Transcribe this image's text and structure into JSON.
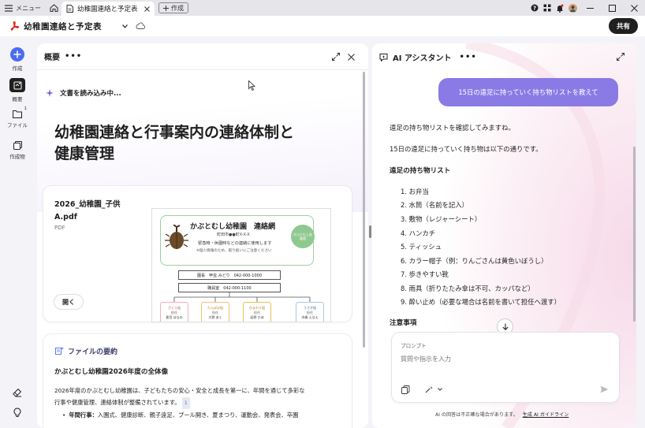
{
  "titlebar": {
    "menu_label": "メニュー",
    "tab_title": "幼稚園連絡と予定表",
    "new_tab_label": "作成"
  },
  "toolbar": {
    "doc_title": "幼稚園連絡と予定表",
    "share_label": "共有"
  },
  "rail": {
    "create": "作成",
    "overview": "概要",
    "files": "ファイル",
    "files_badge": "1",
    "creations": "作成物"
  },
  "left_panel": {
    "title": "概要",
    "reading_status": "文書を読み込み中...",
    "heading_line1": "幼稚園連絡と行事案内の連絡体制と",
    "heading_line2": "健康管理",
    "file_name_line1": "2026_幼稚園_子供",
    "file_name_line2": "A.pdf",
    "file_type": "PDF",
    "open_label": "開く",
    "preview": {
      "school_name": "かぶとむし幼稚園　連絡網",
      "address": "町田市●●町X-X-X",
      "note1": "緊急時・休園時などの連絡に使用します",
      "note2": "※個人情報のため、取り扱いにご注意ください",
      "badge": "かぶとむし幼稚園",
      "principal": "園長　甲虫 みどり　042-000-1000",
      "staffroom": "職員室　042-000-1100",
      "classes": [
        {
          "name": "さくら組",
          "sub": "担任",
          "teacher": "夏目 はなの"
        },
        {
          "name": "たんぽぽ組",
          "sub": "担任",
          "teacher": "大野 あく"
        },
        {
          "name": "ひまわり組",
          "sub": "担任",
          "teacher": "岩野 かほ"
        },
        {
          "name": "うさぎ組",
          "sub": "担任",
          "teacher": "木嶋 えなえ"
        }
      ]
    },
    "summary": {
      "title": "ファイルの要約",
      "subtitle": "かぶとむし幼稚園2026年度の全体像",
      "para_line1": "2026年度のかぶとむし幼稚園は、子どもたちの安心・安全と成長を第一に、年間を通じて多彩な",
      "para_line2": "行事や健康管理、連絡体制が整備されています。",
      "cite": "1",
      "bullet_label": "年間行事：",
      "bullet_text": "入園式、健康診断、親子遠足、プール開き、夏まつり、運動会、発表会、卒園"
    }
  },
  "right_panel": {
    "title": "AI アシスタント",
    "user_message": "15日の遠足に持っていく持ち物リストを教えて",
    "reply1": "遠足の持ち物リストを確認してみますね。",
    "reply2": "15日の遠足に持っていく持ち物は以下の通りです。",
    "list_title": "遠足の持ち物リスト",
    "items": [
      "1. お弁当",
      "2. 水筒（名前を記入）",
      "3. 敷物（レジャーシート）",
      "4. ハンカチ",
      "5. ティッシュ",
      "6. カラー帽子（例：りんごさんは黄色いぼうし）",
      "7. 歩きやすい靴",
      "8. 雨具（折りたたみ傘は不可、カッパなど）",
      "9. 酔い止め（必要な場合は名前を書いて担任へ渡す）"
    ],
    "notes_title": "注意事項",
    "prompt_label": "プロンプト",
    "prompt_placeholder": "質問や指示を入力",
    "disclaimer": "AI の回答は不正確な場合があります。",
    "guideline_link": "生成 AI ガイドライン"
  },
  "colors": {
    "accent": "#4b6cf0",
    "user_bubble": "#8a7ae6",
    "adobe_red": "#e1251b"
  }
}
